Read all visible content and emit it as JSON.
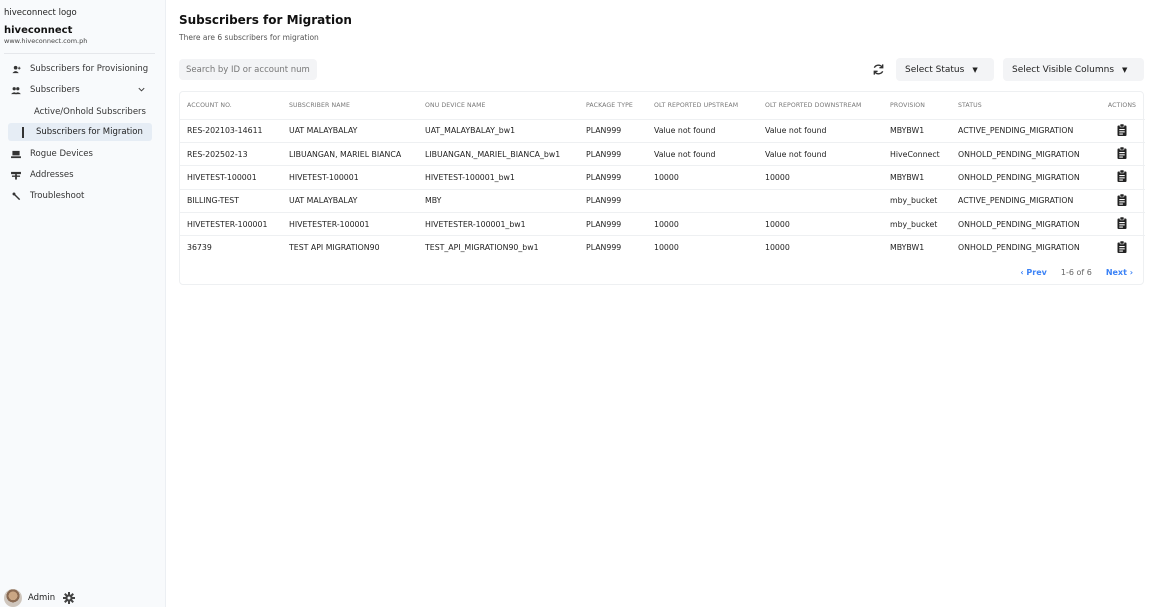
{
  "brand": {
    "logo_alt": "hiveconnect logo",
    "name": "hiveconnect",
    "url": "www.hiveconnect.com.ph"
  },
  "sidebar": {
    "items": [
      {
        "label": "Subscribers for Provisioning",
        "icon": "user-plus-icon"
      },
      {
        "label": "Subscribers",
        "icon": "users-icon"
      },
      {
        "label": "Active/Onhold Subscribers"
      },
      {
        "label": "Subscribers for Migration"
      },
      {
        "label": "Rogue Devices",
        "icon": "devices-icon"
      },
      {
        "label": "Addresses",
        "icon": "address-icon"
      },
      {
        "label": "Troubleshoot",
        "icon": "wrench-icon"
      }
    ],
    "user": {
      "name": "Admin"
    }
  },
  "page": {
    "title": "Subscribers for Migration",
    "subtitle": "There are 6 subscribers for migration"
  },
  "toolbar": {
    "search_placeholder": "Search by ID or account number",
    "status_label": "Select Status",
    "columns_label": "Select Visible Columns"
  },
  "table": {
    "headers": [
      "ACCOUNT NO.",
      "SUBSCRIBER NAME",
      "ONU DEVICE NAME",
      "PACKAGE TYPE",
      "OLT REPORTED UPSTREAM",
      "OLT REPORTED DOWNSTREAM",
      "PROVISION",
      "STATUS",
      "ACTIONS"
    ],
    "rows": [
      [
        "RES-202103-14611",
        "UAT MALAYBALAY",
        "UAT_MALAYBALAY_bw1",
        "PLAN999",
        "Value not found",
        "Value not found",
        "MBYBW1",
        "ACTIVE_PENDING_MIGRATION"
      ],
      [
        "RES-202502-13",
        "LIBUANGAN, MARIEL BIANCA",
        "LIBUANGAN,_MARIEL_BIANCA_bw1",
        "PLAN999",
        "Value not found",
        "Value not found",
        "HiveConnect",
        "ONHOLD_PENDING_MIGRATION"
      ],
      [
        "HIVETEST-100001",
        "HIVETEST-100001",
        "HIVETEST-100001_bw1",
        "PLAN999",
        "10000",
        "10000",
        "MBYBW1",
        "ONHOLD_PENDING_MIGRATION"
      ],
      [
        "BILLING-TEST",
        "UAT MALAYBALAY",
        "MBY",
        "PLAN999",
        "",
        "",
        "mby_bucket",
        "ACTIVE_PENDING_MIGRATION"
      ],
      [
        "HIVETESTER-100001",
        "HIVETESTER-100001",
        "HIVETESTER-100001_bw1",
        "PLAN999",
        "10000",
        "10000",
        "mby_bucket",
        "ONHOLD_PENDING_MIGRATION"
      ],
      [
        "36739",
        "TEST API MIGRATION90",
        "TEST_API_MIGRATION90_bw1",
        "PLAN999",
        "10000",
        "10000",
        "MBYBW1",
        "ONHOLD_PENDING_MIGRATION"
      ]
    ]
  },
  "pagination": {
    "prev": "‹ Prev",
    "info": "1-6 of 6",
    "next": "Next ›"
  }
}
